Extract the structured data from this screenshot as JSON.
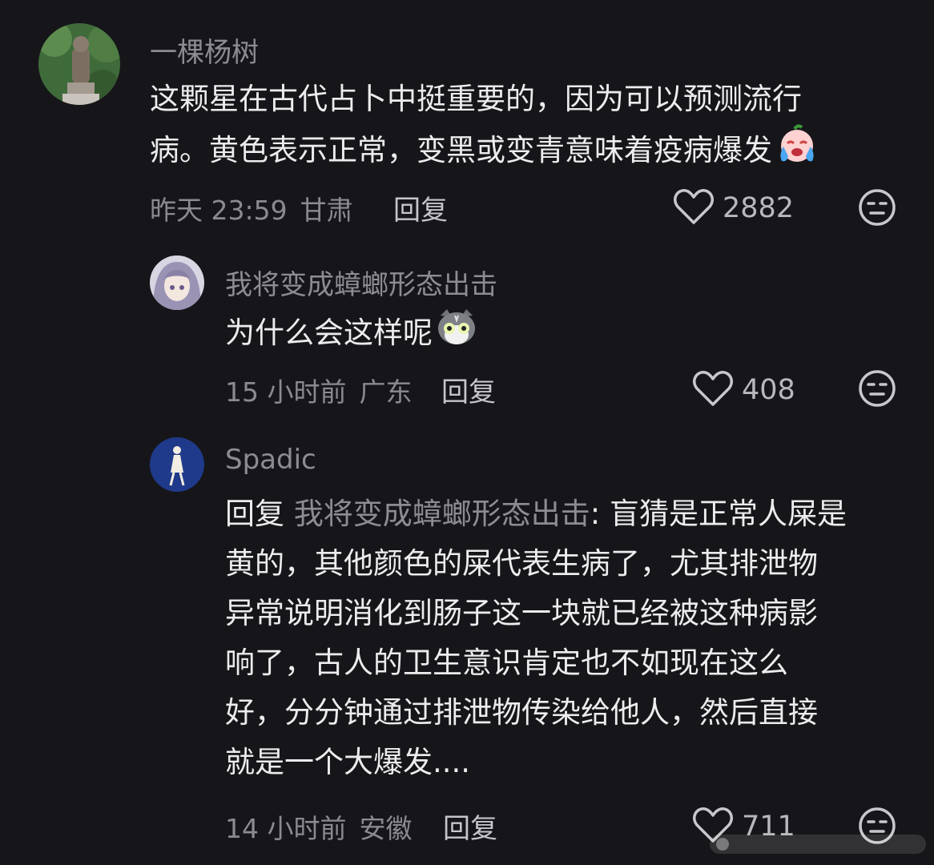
{
  "comments": [
    {
      "username": "一棵杨树",
      "lines": [
        "这颗星在古代占卜中挺重要的，因为可以预测流行",
        "病。黄色表示正常，变黑或变青意味着疫病爆发"
      ],
      "emoji_icon": "crying-laughing-emoji-icon",
      "time": "昨天 23:59",
      "location": "甘肃",
      "reply_label": "回复",
      "likes": "2882",
      "avatar_icon": "statue-avatar"
    },
    {
      "username": "我将变成蟑螂形态出击",
      "lines": [
        "为什么会这样呢"
      ],
      "emoji_icon": "shocked-cat-emoji-icon",
      "time": "15 小时前",
      "location": "广东",
      "reply_label": "回复",
      "likes": "408",
      "avatar_icon": "anime-girl-avatar"
    },
    {
      "username": "Spadic",
      "reply_prefix": "回复",
      "reply_to": "我将变成蟑螂形态出击",
      "lines": [
        ": 盲猜是正常人屎是",
        "黄的，其他颜色的屎代表生病了，尤其排泄物",
        "异常说明消化到肠子这一块就已经被这种病影",
        "响了，古人的卫生意识肯定也不如现在这么",
        "好，分分钟通过排泄物传染给他人，然后直接",
        "就是一个大爆发...."
      ],
      "time": "14 小时前",
      "location": "安徽",
      "reply_label": "回复",
      "likes": "711",
      "avatar_icon": "silhouette-figure-avatar"
    }
  ],
  "colors": {
    "background": "#16161a",
    "text_primary": "#ececee",
    "text_secondary": "#8c8c92",
    "icon": "#c8c8cc"
  }
}
